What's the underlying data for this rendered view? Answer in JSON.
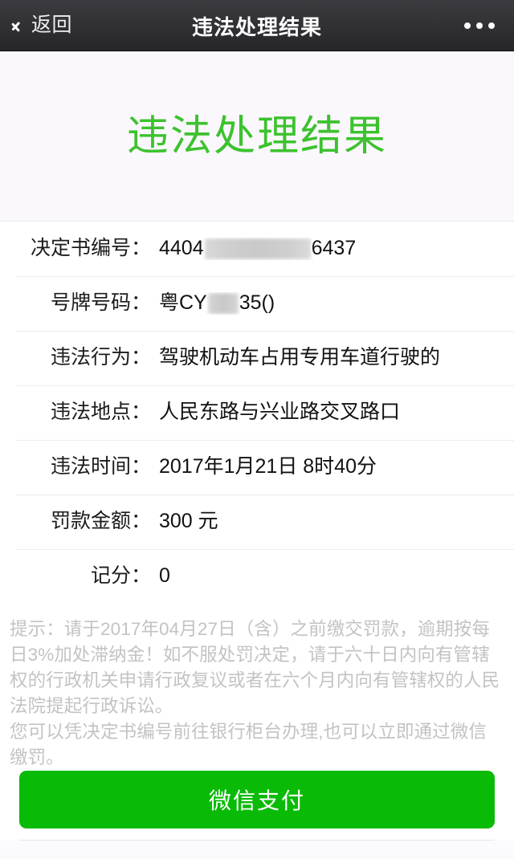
{
  "navbar": {
    "back_label": "返回",
    "back_icon": "chevron-left-icon",
    "title": "违法处理结果",
    "more_icon": "more-dots-icon"
  },
  "hero": {
    "title": "违法处理结果",
    "accent_color": "#3dc22f",
    "background_color": "#faf8fc"
  },
  "detail": {
    "rows": [
      {
        "label": "决定书编号：",
        "value_prefix": "4404",
        "redacted": "long",
        "value_suffix": "6437"
      },
      {
        "label": "号牌号码：",
        "value_prefix": "粤CY",
        "redacted": "short",
        "value_suffix": "35()"
      },
      {
        "label": "违法行为：",
        "value_prefix": "驾驶机动车占用专用车道行驶的",
        "redacted": "none",
        "value_suffix": ""
      },
      {
        "label": "违法地点：",
        "value_prefix": "人民东路与兴业路交叉路口",
        "redacted": "none",
        "value_suffix": ""
      },
      {
        "label": "违法时间：",
        "value_prefix": "2017年1月21日 8时40分",
        "redacted": "none",
        "value_suffix": ""
      },
      {
        "label": "罚款金额：",
        "value_prefix": "300 元",
        "redacted": "none",
        "value_suffix": ""
      },
      {
        "label": "记分：",
        "value_prefix": "0",
        "redacted": "none",
        "value_suffix": ""
      }
    ]
  },
  "notice": {
    "line1": "提示：请于2017年04月27日（含）之前缴交罚款，逾期按每日3%加处滞纳金！如不服处罚决定，请于六十日内向有管辖权的行政机关申请行政复议或者在六个月内向有管辖权的人民法院提起行政诉讼。",
    "line2": "您可以凭决定书编号前往银行柜台办理,也可以立即通过微信缴罚。",
    "text_color": "#c3c3c6"
  },
  "footer": {
    "pay_label": "微信支付",
    "pay_color": "#09bb07"
  }
}
